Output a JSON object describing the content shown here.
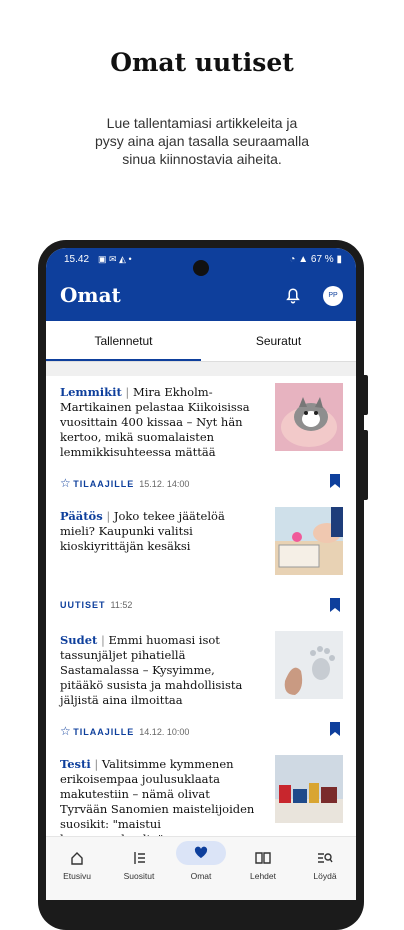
{
  "promo": {
    "title": "Omat uutiset",
    "subtitle": "Lue tallentamiasi artikkeleita ja pysy aina ajan tasalla seuraamalla sinua kiinnostavia aiheita."
  },
  "status_bar": {
    "time": "15.42",
    "battery": "67 %"
  },
  "app": {
    "title": "Omat",
    "avatar_initials": "PP"
  },
  "tabs": [
    {
      "label": "Tallennetut",
      "active": true
    },
    {
      "label": "Seuratut",
      "active": false
    }
  ],
  "articles": [
    {
      "kicker": "Lemmikit",
      "title": "Mira Ekholm-Martikainen pelastaa Kiikoisissa vuosittain 400 kissaa – Nyt hän kertoo, mikä suomalaisten lemmikkisuhteessa mättää",
      "tag": "TILAAJILLE",
      "subscriber_only": true,
      "time": "15.12. 14:00",
      "image": "kitten-photo"
    },
    {
      "kicker": "Päätös",
      "title": "Joko tekee jäätelöä mieli? Kaupunki valitsi kioskiyrittäjän kesäksi",
      "tag": "UUTISET",
      "subscriber_only": false,
      "time": "11:52",
      "image": "ice-cream-kiosk-photo"
    },
    {
      "kicker": "Sudet",
      "title": "Emmi huomasi isot tassunjäljet pihatiellä Sastamalassa – Kysyimme, pitääkö susista ja mahdollisista jäljistä aina ilmoittaa",
      "tag": "TILAAJILLE",
      "subscriber_only": true,
      "time": "14.12. 10:00",
      "image": "paw-print-snow-photo"
    },
    {
      "kicker": "Testi",
      "title": "Valitsimme kymmenen erikoisempaa joulusuklaata makutestiin – nämä olivat Tyrvään Sanomien maistelijoiden suosikit: \"maistui hammasrahnalta\"",
      "tag": "",
      "subscriber_only": false,
      "time": "",
      "image": "chocolate-boxes-photo"
    }
  ],
  "bottom_nav": [
    {
      "label": "Etusivu",
      "icon": "home-icon",
      "active": false
    },
    {
      "label": "Suositut",
      "icon": "list-icon",
      "active": false
    },
    {
      "label": "Omat",
      "icon": "heart-icon",
      "active": true
    },
    {
      "label": "Lehdet",
      "icon": "book-icon",
      "active": false
    },
    {
      "label": "Löydä",
      "icon": "search-list-icon",
      "active": false
    }
  ],
  "colors": {
    "brand": "#0e3f9c",
    "nav_active": "#dbe4f7"
  }
}
